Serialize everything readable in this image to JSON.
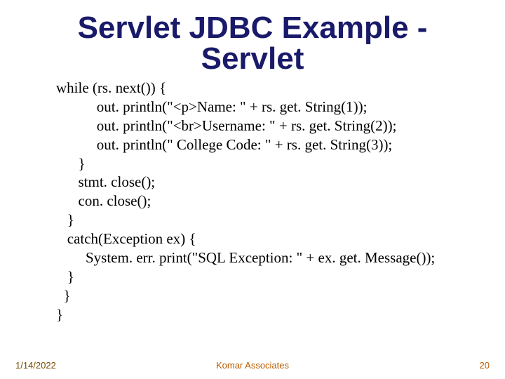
{
  "slide": {
    "title": "Servlet JDBC Example - Servlet",
    "code_lines": [
      "while (rs. next()) {",
      "           out. println(\"<p>Name: \" + rs. get. String(1));",
      "           out. println(\"<br>Username: \" + rs. get. String(2));",
      "           out. println(\" College Code: \" + rs. get. String(3));",
      "      }",
      "      stmt. close();",
      "      con. close();",
      "   }",
      "   catch(Exception ex) {",
      "        System. err. print(\"SQL Exception: \" + ex. get. Message());",
      "   }",
      "  }",
      "}"
    ]
  },
  "footer": {
    "date": "1/14/2022",
    "organization": "Komar Associates",
    "page_number": "20"
  }
}
